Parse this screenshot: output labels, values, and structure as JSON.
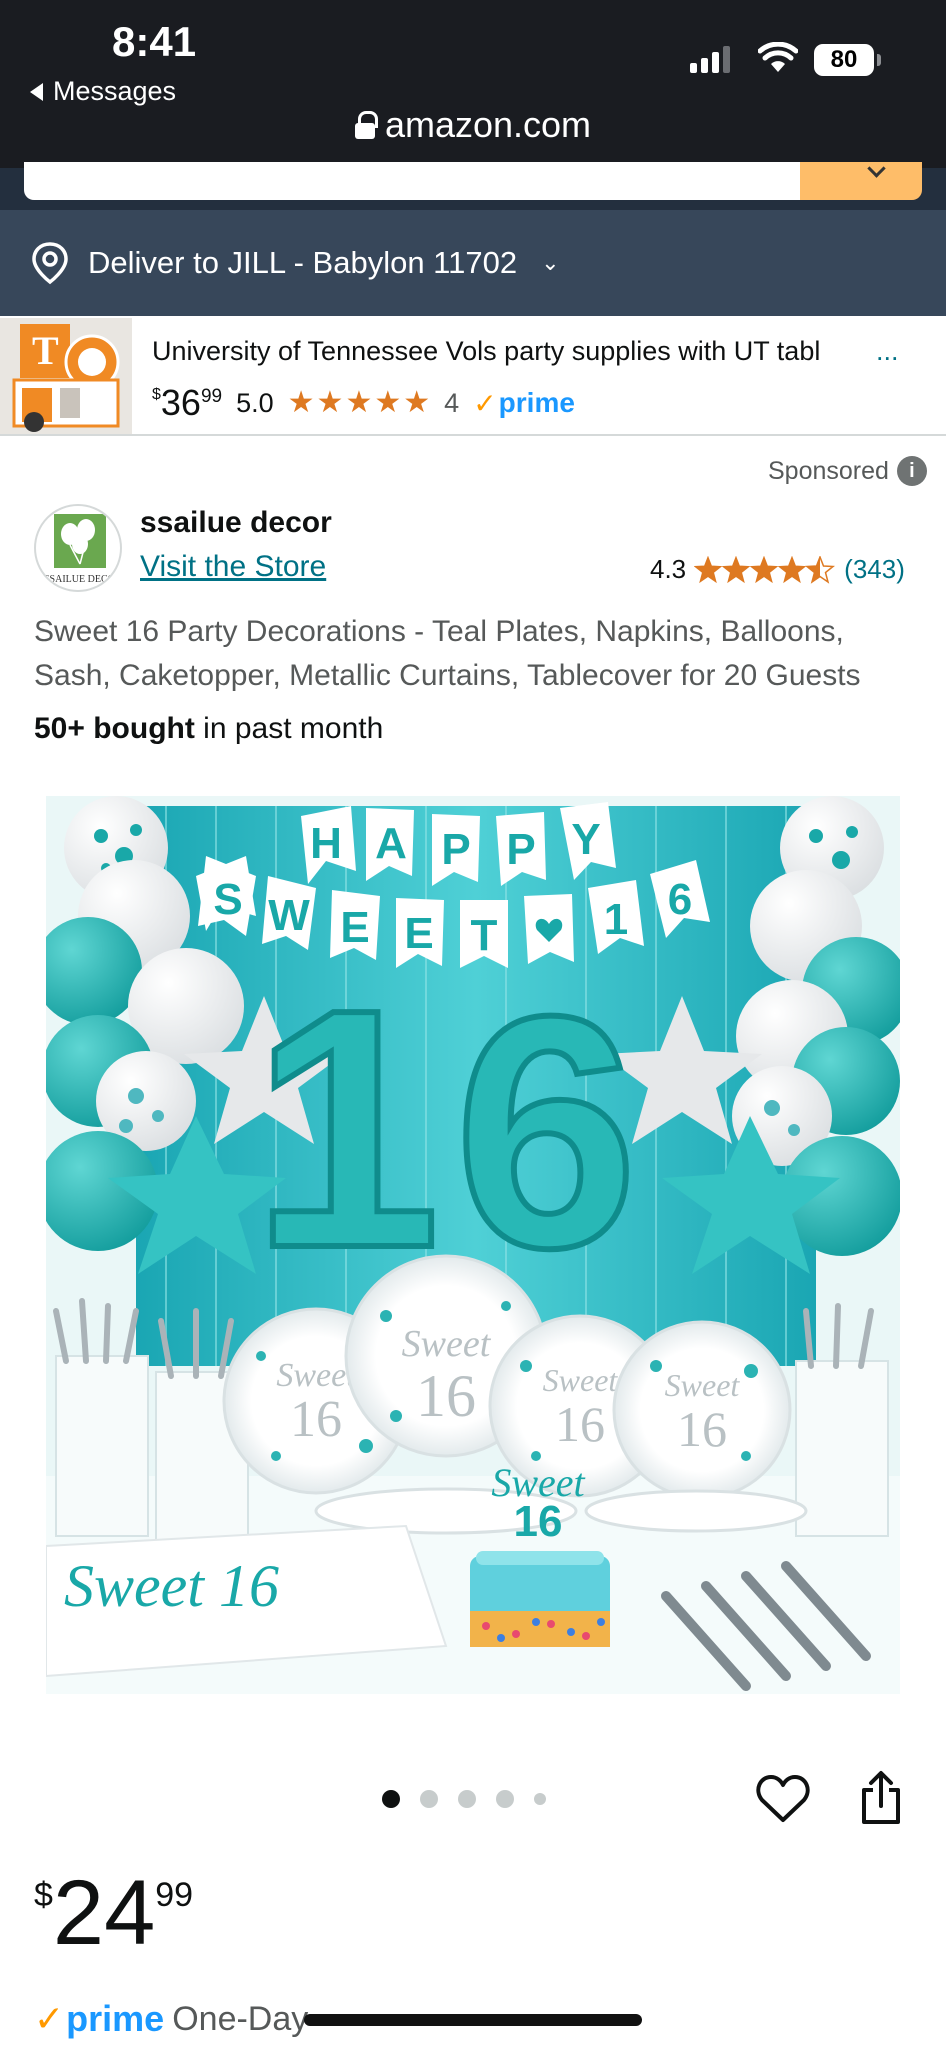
{
  "status_bar": {
    "time": "8:41",
    "back_label": "Messages",
    "battery": "80",
    "url": "amazon.com"
  },
  "deliver": {
    "label": "Deliver to JILL - Babylon 11702",
    "chevron": "⌄"
  },
  "ad": {
    "title": "University of Tennessee Vols party supplies with UT tabl",
    "ellipsis": "...",
    "price_symbol": "$",
    "price_whole": "36",
    "price_fraction": "99",
    "rating": "5.0",
    "review_count": "4",
    "prime_label": "prime",
    "star_color": "#de7921"
  },
  "product": {
    "sponsored_label": "Sponsored",
    "brand": "ssailue decor",
    "store_link": "Visit the Store",
    "rating": "4.3",
    "review_count": "(343)",
    "title": "Sweet 16 Party Decorations - Teal Plates, Napkins, Balloons, Sash, Caketopper, Metallic Curtains, Tablecover for 20 Guests",
    "bought_bold": "50+ bought",
    "bought_rest": " in past month",
    "image": {
      "banner_top": "HAPPY",
      "banner_bottom": "SWEET♥16",
      "number": "16",
      "sash_text": "Sweet 16",
      "plate_text": "Sweet 16",
      "cake_topper": "Sweet 16"
    },
    "carousel": {
      "count": 5,
      "active_index": 0
    },
    "price_symbol": "$",
    "price_whole": "24",
    "price_fraction": "99",
    "prime_label": "prime",
    "delivery_speed": "One-Day"
  },
  "colors": {
    "teal": "#1fb5b5",
    "prime_blue": "#1a98ff",
    "link": "#007185",
    "header_bg": "#1a1c21",
    "deliver_bg": "#37475a"
  }
}
